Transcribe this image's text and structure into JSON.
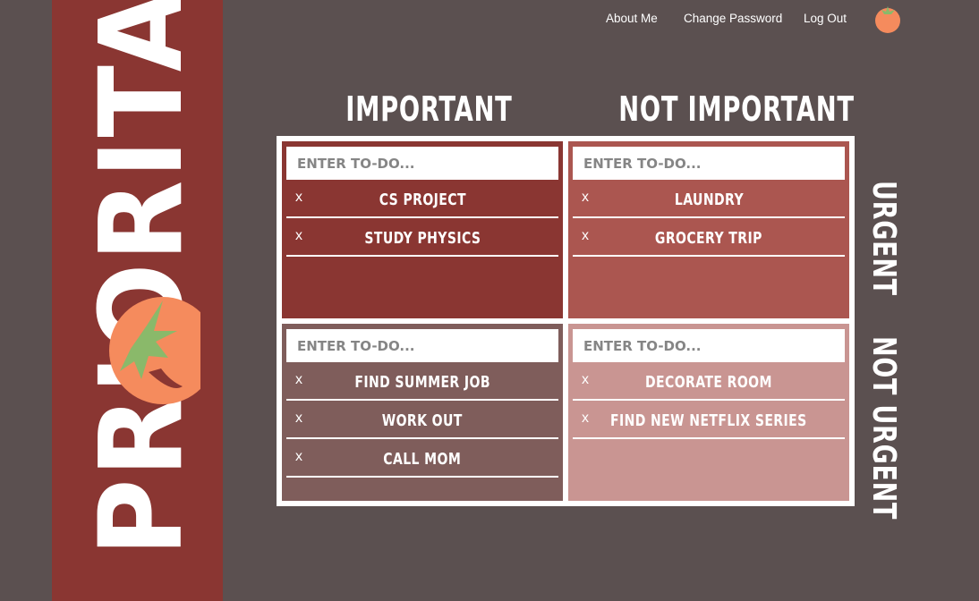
{
  "app": {
    "logo_text": "PRIORITAS"
  },
  "nav": {
    "about": "About Me",
    "change_password": "Change Password",
    "logout": "Log Out",
    "profile_icon": "tomato-icon"
  },
  "headers": {
    "important": "IMPORTANT",
    "not_important": "NOT IMPORTANT",
    "urgent": "URGENT",
    "not_urgent": "NOT URGENT"
  },
  "colors": {
    "sidebar": "#8a3632",
    "background": "#5b5050",
    "q1": "#8a3632",
    "q2": "#ab5650",
    "q3": "#7f5d5b",
    "q4": "#c99592",
    "tomato": "#f58b5d",
    "leaf": "#8ab96a"
  },
  "quadrants": {
    "q1": {
      "placeholder": "ENTER TO-DO...",
      "items": [
        {
          "remove": "x",
          "text": "CS PROJECT"
        },
        {
          "remove": "x",
          "text": "STUDY PHYSICS"
        }
      ]
    },
    "q2": {
      "placeholder": "ENTER TO-DO...",
      "items": [
        {
          "remove": "x",
          "text": "LAUNDRY"
        },
        {
          "remove": "x",
          "text": "GROCERY TRIP"
        }
      ]
    },
    "q3": {
      "placeholder": "ENTER TO-DO...",
      "items": [
        {
          "remove": "x",
          "text": "FIND SUMMER JOB"
        },
        {
          "remove": "x",
          "text": "WORK OUT"
        },
        {
          "remove": "x",
          "text": "CALL MOM"
        }
      ]
    },
    "q4": {
      "placeholder": "ENTER TO-DO...",
      "items": [
        {
          "remove": "x",
          "text": "DECORATE ROOM"
        },
        {
          "remove": "x",
          "text": "FIND NEW NETFLIX SERIES"
        }
      ]
    }
  }
}
